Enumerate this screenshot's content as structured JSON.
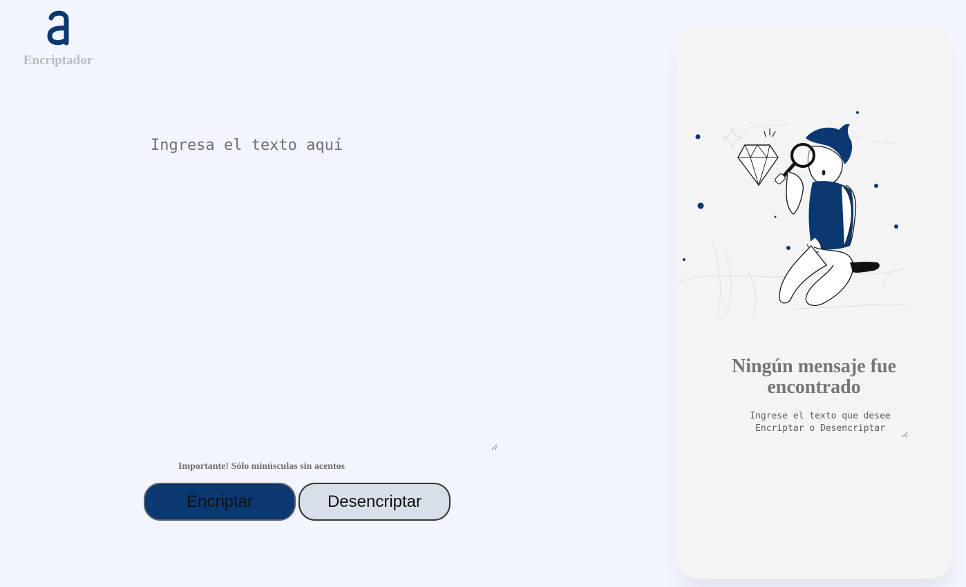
{
  "app": {
    "logo_text": "Encriptador",
    "logo_glyph": "a-logo-icon",
    "brand_color": "#0a3871"
  },
  "editor": {
    "placeholder": "Ingresa el texto aquí",
    "value": ""
  },
  "notice": {
    "icon": "info-icon",
    "text": "Importante! Sólo minúsculas sin acentos"
  },
  "actions": {
    "encrypt_label": "Encriptar",
    "decrypt_label": "Desencriptar"
  },
  "output": {
    "illustration": "person-with-magnifier-and-diamond-illustration",
    "title": "Ningún mensaje fue encontrado",
    "hint_placeholder": "Ingrese el texto que desee Encriptar o Desencriptar"
  }
}
